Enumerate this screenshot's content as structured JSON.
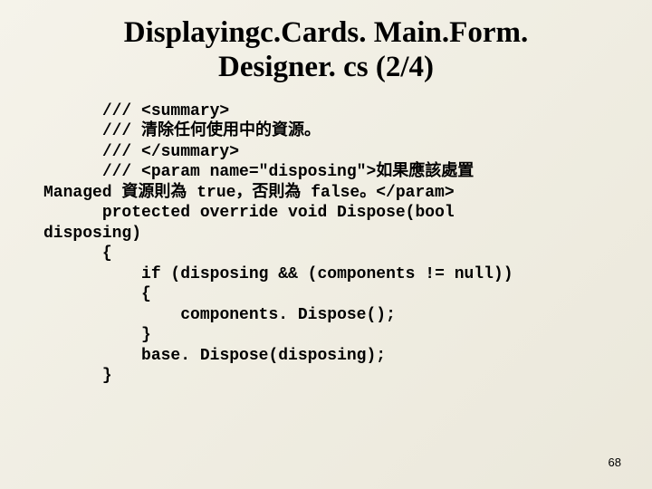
{
  "title_line1": "Displayingc.Cards. Main.Form.",
  "title_line2": "Designer. cs (2/4)",
  "code": "      /// <summary>\n      /// 清除任何使用中的資源。\n      /// </summary>\n      /// <param name=\"disposing\">如果應該處置\nManaged 資源則為 true，否則為 false。</param>\n      protected override void Dispose(bool\ndisposing)\n      {\n          if (disposing && (components != null))\n          {\n              components. Dispose();\n          }\n          base. Dispose(disposing);\n      }",
  "page_number": "68"
}
